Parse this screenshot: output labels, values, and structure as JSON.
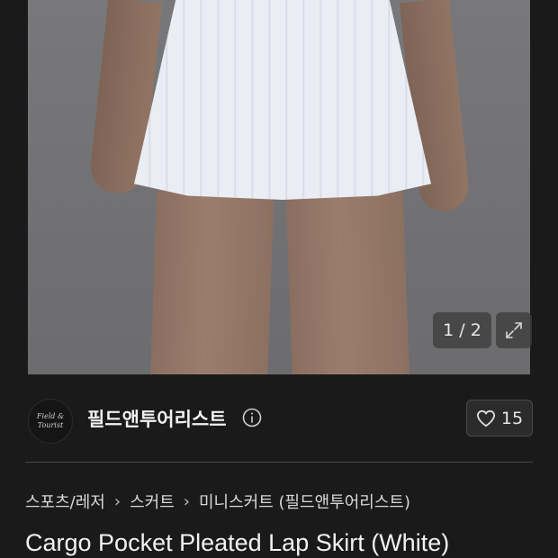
{
  "gallery": {
    "counter": "1 / 2"
  },
  "brand": {
    "logo_line1": "Field &",
    "logo_line2": "Tourist",
    "name": "필드앤투어리스트"
  },
  "like": {
    "count": "15"
  },
  "breadcrumb": [
    "스포츠/레저",
    "스커트",
    "미니스커트 (필드앤투어리스트)"
  ],
  "product": {
    "title": "Cargo Pocket Pleated Lap Skirt (White)"
  }
}
